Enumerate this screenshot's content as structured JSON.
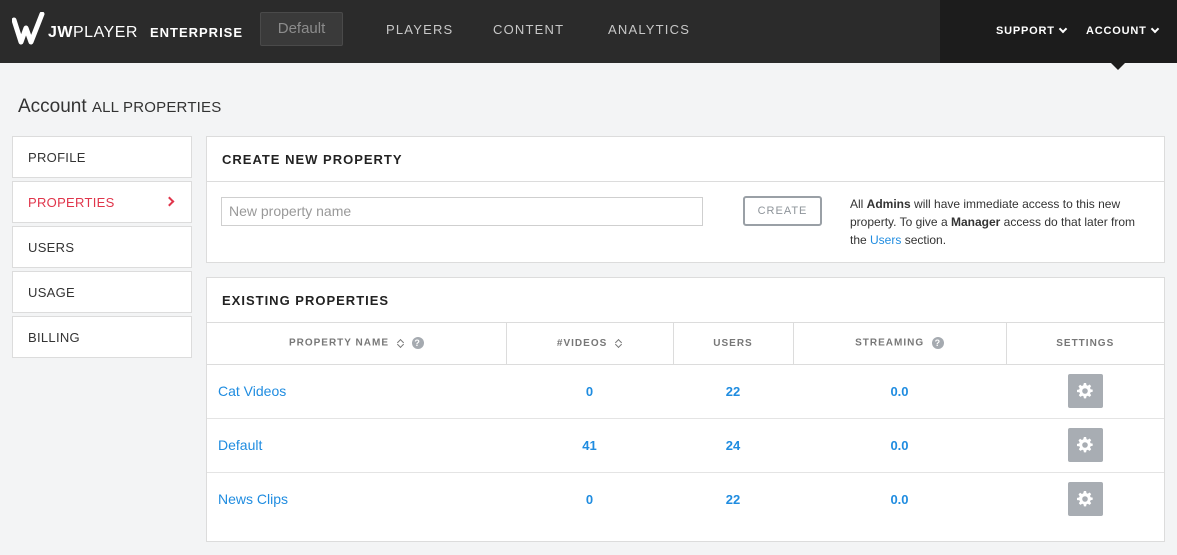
{
  "header": {
    "brand_bold": "JW",
    "brand_rest": "PLAYER",
    "edition": "ENTERPRISE",
    "property_selector": "Default",
    "nav": [
      "PLAYERS",
      "CONTENT",
      "ANALYTICS"
    ],
    "support": "SUPPORT",
    "account": "ACCOUNT"
  },
  "page": {
    "title": "Account",
    "subtitle": "ALL PROPERTIES"
  },
  "sidebar": {
    "items": [
      {
        "label": "PROFILE",
        "active": false
      },
      {
        "label": "PROPERTIES",
        "active": true
      },
      {
        "label": "USERS",
        "active": false
      },
      {
        "label": "USAGE",
        "active": false
      },
      {
        "label": "BILLING",
        "active": false
      }
    ]
  },
  "create": {
    "heading": "CREATE NEW PROPERTY",
    "placeholder": "New property name",
    "button": "CREATE",
    "note_1": "All ",
    "note_admins": "Admins",
    "note_2": " will have immediate access to this new property. To give a ",
    "note_manager": "Manager",
    "note_3": " access do that later from the ",
    "note_users_link": "Users",
    "note_4": " section."
  },
  "existing": {
    "heading": "EXISTING PROPERTIES",
    "columns": [
      "PROPERTY NAME",
      "#VIDEOS",
      "USERS",
      "STREAMING",
      "SETTINGS"
    ],
    "help_glyph": "?",
    "rows": [
      {
        "name": "Cat Videos",
        "videos": "0",
        "users": "22",
        "streaming": "0.0"
      },
      {
        "name": "Default",
        "videos": "41",
        "users": "24",
        "streaming": "0.0"
      },
      {
        "name": "News Clips",
        "videos": "0",
        "users": "22",
        "streaming": "0.0"
      }
    ]
  },
  "colors": {
    "accent_red": "#e0354b",
    "link_blue": "#1f8ce0",
    "topbar": "#2b2b2b"
  },
  "icons": {
    "logo": "jw-logo-icon",
    "settings": "gear-icon",
    "sort": "sort-icon",
    "help": "help-icon",
    "dropdown": "chevron-down-icon",
    "active_indicator": "chevron-right-icon"
  }
}
